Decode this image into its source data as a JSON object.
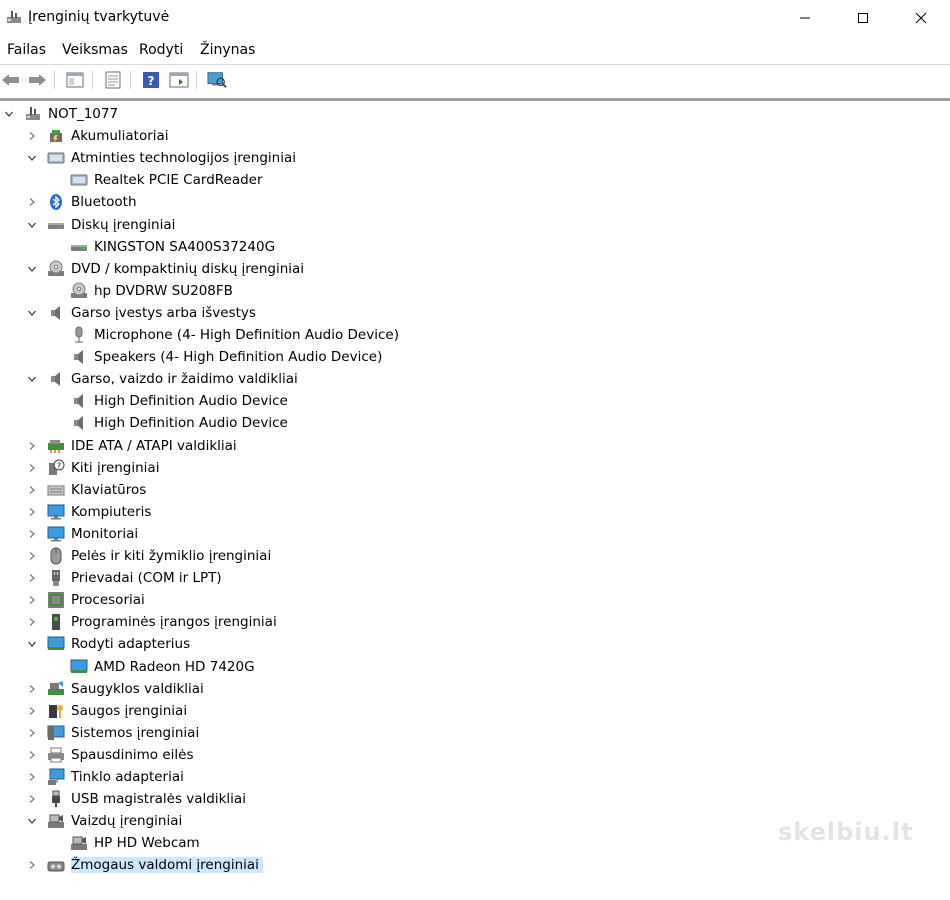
{
  "window": {
    "title": "Įrenginių tvarkytuvė"
  },
  "menu": [
    "Failas",
    "Veiksmas",
    "Rodyti",
    "Žinynas"
  ],
  "tree": {
    "root": "NOT_1077",
    "categories": [
      {
        "label": "Akumuliatoriai",
        "icon": "battery-icon",
        "expanded": false,
        "children": []
      },
      {
        "label": "Atminties technologijos įrenginiai",
        "icon": "memory-device-icon",
        "expanded": true,
        "children": [
          {
            "label": "Realtek PCIE CardReader",
            "icon": "card-reader-icon"
          }
        ]
      },
      {
        "label": "Bluetooth",
        "icon": "bluetooth-icon",
        "expanded": false,
        "children": []
      },
      {
        "label": "Diskų įrenginiai",
        "icon": "disk-drive-icon",
        "expanded": true,
        "children": [
          {
            "label": "KINGSTON SA400S37240G",
            "icon": "disk-drive-icon"
          }
        ]
      },
      {
        "label": "DVD / kompaktinių diskų įrenginiai",
        "icon": "dvd-icon",
        "expanded": true,
        "children": [
          {
            "label": "hp DVDRW  SU208FB",
            "icon": "dvd-icon"
          }
        ]
      },
      {
        "label": "Garso įvestys arba išvestys",
        "icon": "speaker-icon",
        "expanded": true,
        "children": [
          {
            "label": "Microphone (4- High Definition Audio Device)",
            "icon": "microphone-icon"
          },
          {
            "label": "Speakers (4- High Definition Audio Device)",
            "icon": "speaker-icon"
          }
        ]
      },
      {
        "label": "Garso, vaizdo ir žaidimo valdikliai",
        "icon": "speaker-icon",
        "expanded": true,
        "children": [
          {
            "label": "High Definition Audio Device",
            "icon": "speaker-icon"
          },
          {
            "label": "High Definition Audio Device",
            "icon": "speaker-icon"
          }
        ]
      },
      {
        "label": "IDE ATA / ATAPI valdikliai",
        "icon": "ide-controller-icon",
        "expanded": false,
        "children": []
      },
      {
        "label": "Kiti įrenginiai",
        "icon": "unknown-device-icon",
        "expanded": false,
        "children": []
      },
      {
        "label": "Klaviatūros",
        "icon": "keyboard-icon",
        "expanded": false,
        "children": []
      },
      {
        "label": "Kompiuteris",
        "icon": "computer-icon",
        "expanded": false,
        "children": []
      },
      {
        "label": "Monitoriai",
        "icon": "monitor-icon",
        "expanded": false,
        "children": []
      },
      {
        "label": "Pelės ir kiti žymiklio įrenginiai",
        "icon": "mouse-icon",
        "expanded": false,
        "children": []
      },
      {
        "label": "Prievadai (COM ir LPT)",
        "icon": "port-icon",
        "expanded": false,
        "children": []
      },
      {
        "label": "Procesoriai",
        "icon": "processor-icon",
        "expanded": false,
        "children": []
      },
      {
        "label": "Programinės įrangos įrenginiai",
        "icon": "software-device-icon",
        "expanded": false,
        "children": []
      },
      {
        "label": "Rodyti adapterius",
        "icon": "display-adapter-icon",
        "expanded": true,
        "children": [
          {
            "label": "AMD Radeon HD 7420G",
            "icon": "display-adapter-icon"
          }
        ]
      },
      {
        "label": "Saugyklos valdikliai",
        "icon": "storage-controller-icon",
        "expanded": false,
        "children": []
      },
      {
        "label": "Saugos įrenginiai",
        "icon": "security-device-icon",
        "expanded": false,
        "children": []
      },
      {
        "label": "Sistemos įrenginiai",
        "icon": "system-device-icon",
        "expanded": false,
        "children": []
      },
      {
        "label": "Spausdinimo eilės",
        "icon": "printer-icon",
        "expanded": false,
        "children": []
      },
      {
        "label": "Tinklo adapteriai",
        "icon": "network-adapter-icon",
        "expanded": false,
        "children": []
      },
      {
        "label": "USB magistralės valdikliai",
        "icon": "usb-icon",
        "expanded": false,
        "children": []
      },
      {
        "label": "Vaizdų įrenginiai",
        "icon": "camera-icon",
        "expanded": true,
        "children": [
          {
            "label": "HP HD Webcam",
            "icon": "camera-icon"
          }
        ]
      },
      {
        "label": "Žmogaus valdomi įrenginiai",
        "icon": "hid-icon",
        "expanded": false,
        "selected": true,
        "children": []
      }
    ]
  },
  "watermark": "skelbiu.lt"
}
